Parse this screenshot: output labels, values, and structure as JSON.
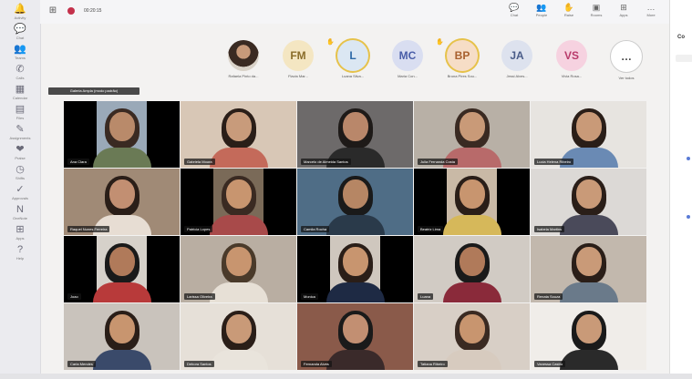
{
  "app": {
    "timer": "00:20:15"
  },
  "rail": [
    {
      "label": "Activity",
      "icon": "bell-icon",
      "glyph": "🔔"
    },
    {
      "label": "Chat",
      "icon": "chat-icon",
      "glyph": "💬"
    },
    {
      "label": "Teams",
      "icon": "teams-icon",
      "glyph": "👥"
    },
    {
      "label": "Calls",
      "icon": "phone-icon",
      "glyph": "✆"
    },
    {
      "label": "Calendar",
      "icon": "calendar-icon",
      "glyph": "▦"
    },
    {
      "label": "Files",
      "icon": "file-icon",
      "glyph": "▤"
    },
    {
      "label": "Assignments",
      "icon": "assignment-icon",
      "glyph": "✎"
    },
    {
      "label": "Praise",
      "icon": "praise-icon",
      "glyph": "❤"
    },
    {
      "label": "Shifts",
      "icon": "shifts-icon",
      "glyph": "◷"
    },
    {
      "label": "Approvals",
      "icon": "approvals-icon",
      "glyph": "✓"
    },
    {
      "label": "OneNote",
      "icon": "onenote-icon",
      "glyph": "N"
    },
    {
      "label": "Apps",
      "icon": "apps-icon",
      "glyph": "⊞"
    },
    {
      "label": "Help",
      "icon": "help-icon",
      "glyph": "?"
    }
  ],
  "top_actions": [
    {
      "label": "Chat",
      "icon": "chat-icon",
      "glyph": "💬"
    },
    {
      "label": "People",
      "icon": "people-icon",
      "glyph": "👥"
    },
    {
      "label": "Raise",
      "icon": "raise-hand-icon",
      "glyph": "✋"
    },
    {
      "label": "Rooms",
      "icon": "rooms-icon",
      "glyph": "▣"
    },
    {
      "label": "Apps",
      "icon": "apps-icon",
      "glyph": "⊞"
    },
    {
      "label": "More",
      "icon": "more-icon",
      "glyph": "…"
    }
  ],
  "participants": [
    {
      "initials": "",
      "name": "Rafaela Pinto da...",
      "photo": true,
      "color": "",
      "bg": "",
      "hand": false,
      "hl": false
    },
    {
      "initials": "FM",
      "name": "Flavia Mar...",
      "photo": false,
      "color": "#8a6d2a",
      "bg": "#f4e6c2",
      "hand": false,
      "hl": false
    },
    {
      "initials": "L",
      "name": "Luana Silva...",
      "photo": false,
      "color": "#2e6aa8",
      "bg": "#dbe7f3",
      "hand": true,
      "hl": true
    },
    {
      "initials": "MC",
      "name": "Maria Con...",
      "photo": false,
      "color": "#4a5ea8",
      "bg": "#d9def1",
      "hand": false,
      "hl": false
    },
    {
      "initials": "BP",
      "name": "Bruna Pires Sou...",
      "photo": false,
      "color": "#a8602e",
      "bg": "#f6ddc6",
      "hand": true,
      "hl": true
    },
    {
      "initials": "JA",
      "name": "Jessi Alves...",
      "photo": false,
      "color": "#4a5c88",
      "bg": "#dde2ee",
      "hand": false,
      "hl": false
    },
    {
      "initials": "VS",
      "name": "Vivia Rosa...",
      "photo": false,
      "color": "#b83a6a",
      "bg": "#f6d2e0",
      "hand": false,
      "hl": false
    },
    {
      "initials": "…",
      "name": "Ver todos",
      "photo": false,
      "color": "#444",
      "bg": "#ffffff",
      "hand": false,
      "hl": false
    }
  ],
  "view_label": "Galeria Ampla (modo padrão)",
  "tiles": [
    {
      "name": "Ana Clara",
      "bars": true,
      "bg": "#9aa9b8",
      "hair": "#3a2a22",
      "skin": "#b98a6a",
      "shirt": "#6a7a55"
    },
    {
      "name": "Gabriela Moura",
      "bars": false,
      "bg": "#d8c7b6",
      "hair": "#2a1e18",
      "skin": "#c89b7b",
      "shirt": "#c46a5a"
    },
    {
      "name": "Marcelo de Almeida Santos",
      "bars": false,
      "bg": "#6d6a6a",
      "hair": "#1e1a18",
      "skin": "#b9876a",
      "shirt": "#2a2a2a"
    },
    {
      "name": "Julia Fernanda Costa",
      "bars": false,
      "bg": "#b8b0a6",
      "hair": "#3a2a22",
      "skin": "#c99a78",
      "shirt": "#b86a6a"
    },
    {
      "name": "Lucia Helena Ribeiro",
      "bars": false,
      "bg": "#e7e4e0",
      "hair": "#2a1e18",
      "skin": "#c99a78",
      "shirt": "#6a8ab4"
    },
    {
      "name": "Raquel Nunes Ferreira",
      "bars": false,
      "bg": "#a08a76",
      "hair": "#2a1e18",
      "skin": "#c28f72",
      "shirt": "#e7ddd3"
    },
    {
      "name": "Patricia Lopes",
      "bars": true,
      "bg": "#7a6a58",
      "hair": "#3a2a22",
      "skin": "#c8956f",
      "shirt": "#a84a4a"
    },
    {
      "name": "Camila Rocha",
      "bars": false,
      "bg": "#4f6d86",
      "hair": "#1a1a1a",
      "skin": "#b68664",
      "shirt": "#2a3a4a"
    },
    {
      "name": "Beatriz Lima",
      "bars": true,
      "bg": "#c9b9a6",
      "hair": "#2a1e18",
      "skin": "#c8956f",
      "shirt": "#d6b85a"
    },
    {
      "name": "Isabela Martins",
      "bars": false,
      "bg": "#dcd9d6",
      "hair": "#2a1e18",
      "skin": "#c99a78",
      "shirt": "#4a4a5a"
    },
    {
      "name": "Joao",
      "bars": true,
      "bg": "#d6d1ca",
      "hair": "#1a1a1a",
      "skin": "#b07a5a",
      "shirt": "#b83a3a"
    },
    {
      "name": "Larissa Oliveira",
      "bars": false,
      "bg": "#b9aea2",
      "hair": "#4a3a2a",
      "skin": "#c8956f",
      "shirt": "#e7e0d6"
    },
    {
      "name": "Monica",
      "bars": true,
      "bg": "#cfc7be",
      "hair": "#2a1e18",
      "skin": "#c8956f",
      "shirt": "#1e2a44"
    },
    {
      "name": "Luana",
      "bars": false,
      "bg": "#d1cbc4",
      "hair": "#1a1a1a",
      "skin": "#b07a5a",
      "shirt": "#8a2a3a"
    },
    {
      "name": "Renata Souza",
      "bars": false,
      "bg": "#c2b8ad",
      "hair": "#2a1e18",
      "skin": "#c99a78",
      "shirt": "#6a7a8a"
    },
    {
      "name": "Carla Mendes",
      "bars": false,
      "bg": "#c9c3bc",
      "hair": "#2a1e18",
      "skin": "#c8956f",
      "shirt": "#3a4a6a"
    },
    {
      "name": "Debora Santos",
      "bars": false,
      "bg": "#e6e0d8",
      "hair": "#2a1e18",
      "skin": "#c99a78",
      "shirt": "#e9e4dc"
    },
    {
      "name": "Fernanda Alves",
      "bars": false,
      "bg": "#8a5a4a",
      "hair": "#1a1a1a",
      "skin": "#c28f72",
      "shirt": "#3a2a2a"
    },
    {
      "name": "Tatiana Ribeiro",
      "bars": false,
      "bg": "#d8cfc6",
      "hair": "#3a2a22",
      "skin": "#c8956f",
      "shirt": "#d7cbbf"
    },
    {
      "name": "Vanessa Castro",
      "bars": false,
      "bg": "#f0ede9",
      "hair": "#1a1a1a",
      "skin": "#c99a78",
      "shirt": "#2a2a2a"
    }
  ],
  "right_panel": {
    "title": "Co"
  }
}
